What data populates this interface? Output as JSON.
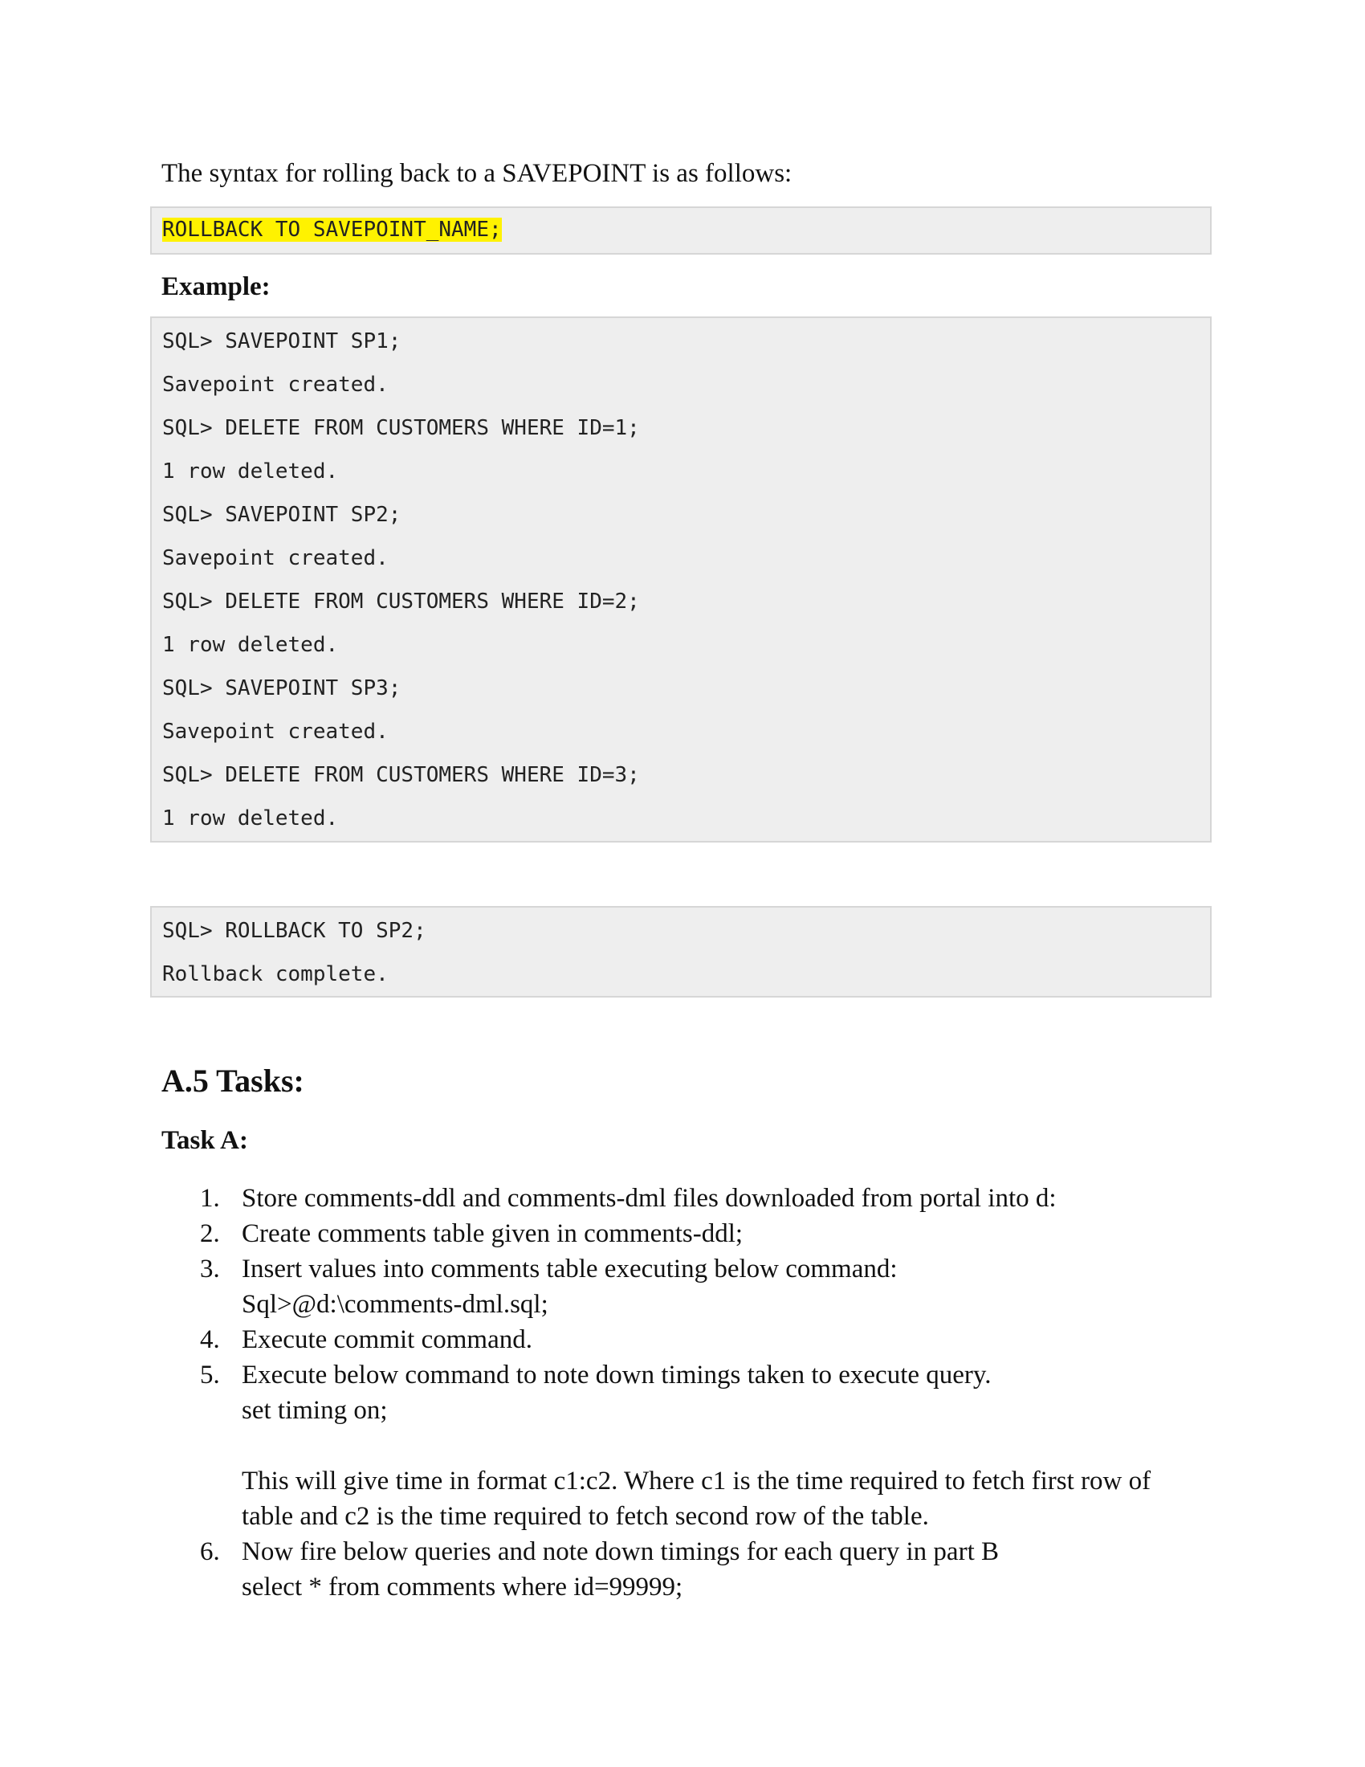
{
  "intro": "The syntax for rolling back to a SAVEPOINT is as follows:",
  "syntax": "ROLLBACK TO SAVEPOINT_NAME;",
  "highlight_color": "#fff200",
  "example_label": "Example:",
  "example_lines": [
    "SQL> SAVEPOINT SP1;",
    "Savepoint created.",
    "SQL> DELETE FROM CUSTOMERS WHERE ID=1;",
    "1 row deleted.",
    "SQL> SAVEPOINT SP2;",
    "Savepoint created.",
    "SQL> DELETE FROM CUSTOMERS WHERE ID=2;",
    "1 row deleted.",
    "SQL> SAVEPOINT SP3;",
    "Savepoint created.",
    "SQL> DELETE FROM CUSTOMERS WHERE ID=3;",
    "1 row deleted."
  ],
  "rollback_lines": [
    "SQL> ROLLBACK TO SP2;",
    "Rollback complete."
  ],
  "section_heading": "A.5 Tasks:",
  "task_heading": "Task A:",
  "tasks": [
    {
      "num": "1.",
      "line1": "Store comments-ddl and comments-dml files downloaded from portal into d:"
    },
    {
      "num": "2.",
      "line1": "Create comments table given in comments-ddl;"
    },
    {
      "num": "3.",
      "line1": "Insert values into comments table executing below command:",
      "line2": "Sql>@d:\\comments-dml.sql;"
    },
    {
      "num": "4.",
      "line1": "Execute commit command."
    },
    {
      "num": "5.",
      "line1": "Execute below command to note down timings taken to execute query.",
      "line2": "set timing on;",
      "line4": "This will give time in format c1:c2. Where c1 is the time required to fetch first row of",
      "line5": "table and c2 is the time required to fetch second row of the table."
    },
    {
      "num": "6.",
      "line1": "Now fire below queries and note down timings for each query in part B",
      "line2": "select * from comments where id=99999;"
    }
  ]
}
